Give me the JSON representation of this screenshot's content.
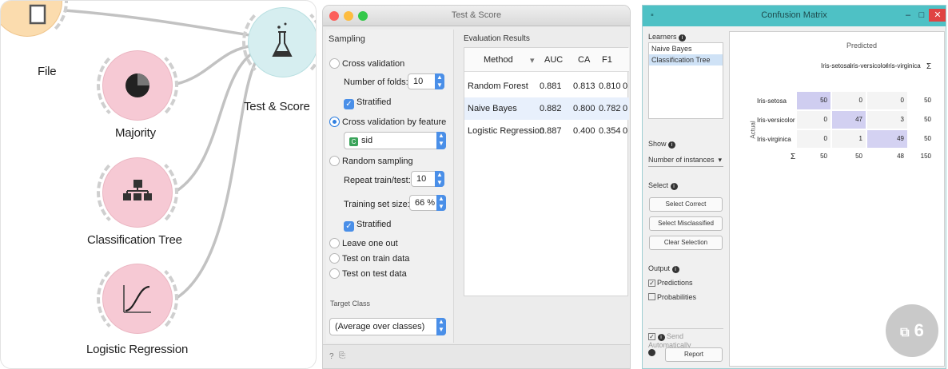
{
  "canvas": {
    "widgets": [
      {
        "label": "File",
        "icon": "file-icon",
        "color": "#fbdcae"
      },
      {
        "label": "Majority",
        "icon": "pie-chart-icon",
        "color": "#f6c9d4"
      },
      {
        "label": "Classification Tree",
        "icon": "tree-icon",
        "color": "#f6c9d4"
      },
      {
        "label": "Logistic Regression",
        "icon": "sigmoid-icon",
        "color": "#f6c9d4"
      },
      {
        "label": "Test & Score",
        "icon": "flask-icon",
        "color": "#d6eef0"
      }
    ]
  },
  "test_score": {
    "title": "Test & Score",
    "sampling_title": "Sampling",
    "cross_validation": "Cross validation",
    "folds_label": "Number of folds:",
    "folds_value": "10",
    "stratified": "Stratified",
    "cv_by_feature": "Cross validation by feature",
    "feature_value": "sid",
    "random_sampling": "Random sampling",
    "repeat_label": "Repeat train/test:",
    "repeat_value": "10",
    "train_size_label": "Training set size:",
    "train_size_value": "66 %",
    "stratified2": "Stratified",
    "leave_one_out": "Leave one out",
    "test_train": "Test on train data",
    "test_test": "Test on test data",
    "target_title": "Target Class",
    "target_value": "(Average over classes)",
    "results_title": "Evaluation Results",
    "columns": [
      "Method",
      "AUC",
      "CA",
      "F1"
    ],
    "rows": [
      {
        "method": "Random Forest",
        "auc": "0.881",
        "ca": "0.813",
        "f1": "0.810",
        "more": "0"
      },
      {
        "method": "Naive Bayes",
        "auc": "0.882",
        "ca": "0.800",
        "f1": "0.782",
        "more": "0"
      },
      {
        "method": "Logistic Regression",
        "auc": "0.887",
        "ca": "0.400",
        "f1": "0.354",
        "more": "0"
      }
    ]
  },
  "confusion": {
    "title": "Confusion Matrix",
    "learners_title": "Learners",
    "learners": [
      "Naive Bayes",
      "Classification Tree"
    ],
    "selected_learner": "Classification Tree",
    "show_title": "Show",
    "show_value": "Number of instances",
    "select_title": "Select",
    "btn_correct": "Select Correct",
    "btn_misclass": "Select Misclassified",
    "btn_clear": "Clear Selection",
    "output_title": "Output",
    "predictions": "Predictions",
    "probabilities": "Probabilities",
    "send_auto": "Send Automatically",
    "report": "Report",
    "predicted_label": "Predicted",
    "actual_label": "Actual",
    "classes": [
      "Iris-setosa",
      "Iris-versicolor",
      "Iris-virginica"
    ],
    "col_sigma": "Σ",
    "row_sigma": "Σ",
    "matrix": [
      [
        "50",
        "0",
        "0",
        "50"
      ],
      [
        "0",
        "47",
        "3",
        "50"
      ],
      [
        "0",
        "1",
        "49",
        "50"
      ]
    ],
    "totals": [
      "50",
      "50",
      "48",
      "150"
    ],
    "badge": "6"
  }
}
